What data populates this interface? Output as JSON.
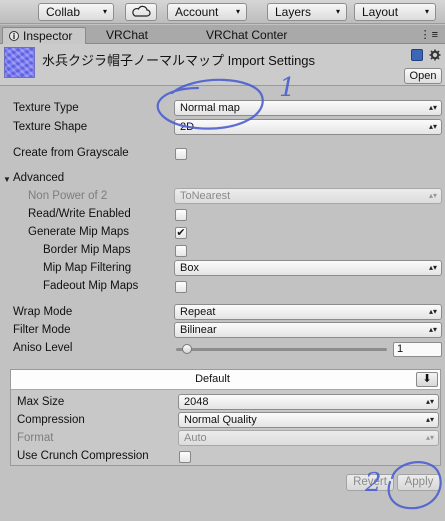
{
  "toolbar": {
    "collab_label": "Collab",
    "cloud_icon": "cloud-icon",
    "account_label": "Account",
    "layers_label": "Layers",
    "layout_label": "Layout",
    "caret": "▾"
  },
  "tabs": [
    {
      "label": "Inspector",
      "icon": "inspector-icon",
      "active": true
    },
    {
      "label": "VRChat",
      "active": false
    },
    {
      "label": "VRChat Conter",
      "active": false
    }
  ],
  "tab_menu_glyph": "⋮≡",
  "header": {
    "title": "水兵クジラ帽子ノーマルマップ Import Settings",
    "open_label": "Open",
    "icons": [
      "help-book-icon",
      "settings-gear-icon"
    ]
  },
  "settings": {
    "texture_type": {
      "label": "Texture Type",
      "value": "Normal map"
    },
    "texture_shape": {
      "label": "Texture Shape",
      "value": "2D"
    },
    "create_from_grayscale": {
      "label": "Create from Grayscale",
      "checked": false
    },
    "advanced": {
      "label": "Advanced",
      "expanded": true
    },
    "non_power_of_2": {
      "label": "Non Power of 2",
      "value": "ToNearest",
      "disabled": true
    },
    "read_write": {
      "label": "Read/Write Enabled",
      "checked": false
    },
    "generate_mip_maps": {
      "label": "Generate Mip Maps",
      "checked": true
    },
    "border_mip_maps": {
      "label": "Border Mip Maps",
      "checked": false
    },
    "mip_map_filtering": {
      "label": "Mip Map Filtering",
      "value": "Box"
    },
    "fadeout_mip_maps": {
      "label": "Fadeout Mip Maps",
      "checked": false
    },
    "wrap_mode": {
      "label": "Wrap Mode",
      "value": "Repeat"
    },
    "filter_mode": {
      "label": "Filter Mode",
      "value": "Bilinear"
    },
    "aniso_level": {
      "label": "Aniso Level",
      "value": "1",
      "slider_fraction": 0.0
    }
  },
  "platform": {
    "tab_label": "Default",
    "download_icon": "download-arrow-icon",
    "max_size": {
      "label": "Max Size",
      "value": "2048"
    },
    "compression": {
      "label": "Compression",
      "value": "Normal Quality"
    },
    "format": {
      "label": "Format",
      "value": "Auto",
      "disabled": true
    },
    "use_crunch": {
      "label": "Use Crunch Compression",
      "checked": false
    }
  },
  "footer": {
    "revert_label": "Revert",
    "apply_label": "Apply"
  },
  "annotations": {
    "label_1": "1",
    "label_2": "2",
    "color": "#4a5fd0"
  },
  "glyphs": {
    "updown": "▴▾",
    "check": "✔",
    "fold_open": "▼",
    "down_arrow": "⬇"
  }
}
